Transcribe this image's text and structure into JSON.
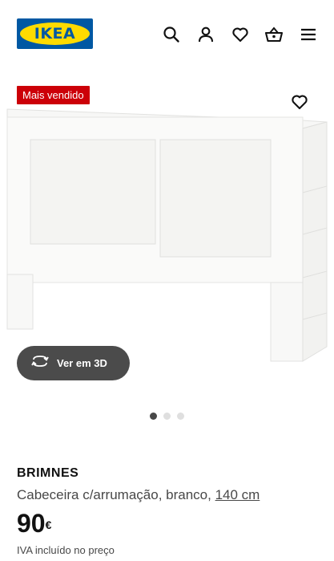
{
  "header": {
    "logo_text": "IKEA",
    "icons": [
      "search-icon",
      "user-icon",
      "heart-icon",
      "basket-icon",
      "menu-icon"
    ]
  },
  "product": {
    "badge": "Mais vendido",
    "view_3d_label": "Ver em 3D",
    "name": "BRIMNES",
    "description": "Cabeceira c/arrumação, branco,",
    "size": "140 cm",
    "price": "90",
    "currency": "€",
    "vat_note": "IVA incluído no preço"
  },
  "gallery": {
    "dots_total": 3,
    "active_index": 0
  },
  "colors": {
    "brand_blue": "#0058a3",
    "brand_yellow": "#ffdb00",
    "badge_red": "#cc0008",
    "button_gray": "#4b4b4b"
  }
}
